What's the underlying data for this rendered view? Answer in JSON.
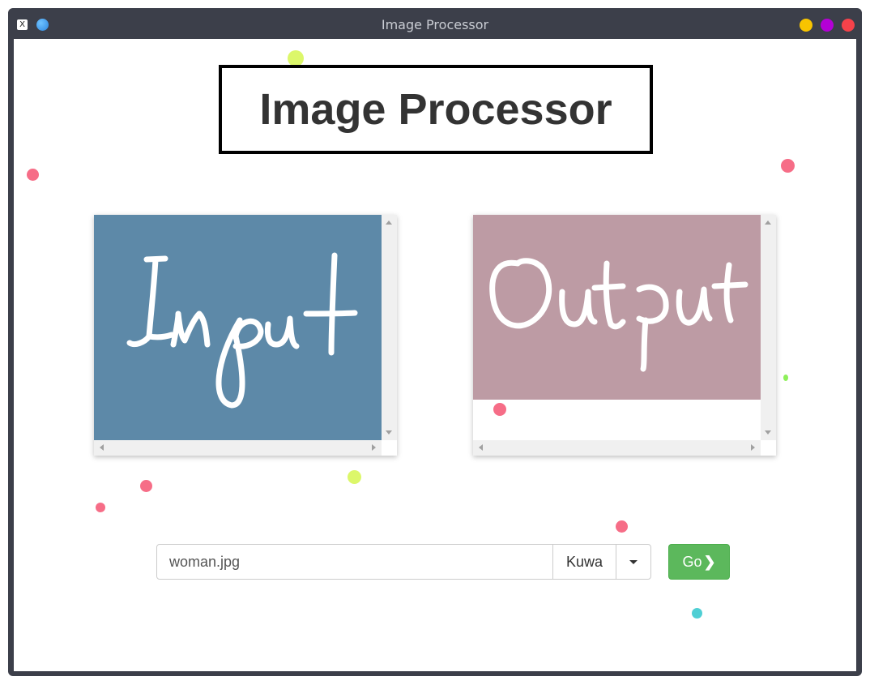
{
  "window": {
    "title": "Image Processor",
    "app_icon_glyph": "X"
  },
  "page": {
    "heading": "Image Processor"
  },
  "input_panel": {
    "label_word": "Input",
    "bg_color": "#5d89a8"
  },
  "output_panel": {
    "label_word": "Output",
    "bg_color": "#bd9ba4"
  },
  "controls": {
    "file_value": "woman.jpg",
    "filter_selected": "Kuwa",
    "go_label": "Go",
    "go_icon": "chevron-right-icon"
  },
  "colors": {
    "accent_green": "#5cb85c",
    "dot_pink": "#f66d87",
    "dot_yellow": "#dcf76a",
    "dot_teal": "#4fcfd4",
    "dot_green": "#8ef05a"
  }
}
